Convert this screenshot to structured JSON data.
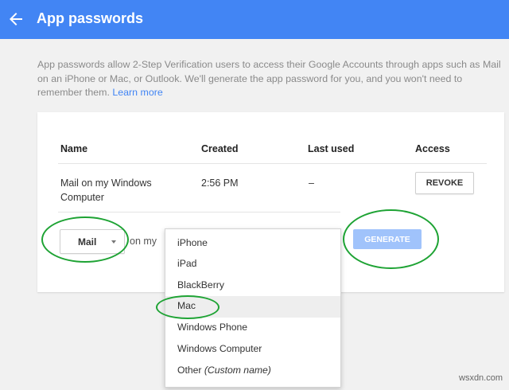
{
  "header": {
    "title": "App passwords",
    "back_icon": "arrow-left-icon",
    "color": "#4285f4"
  },
  "intro": {
    "text": "App passwords allow 2-Step Verification users to access their Google Accounts through apps such as Mail on an iPhone or Mac, or Outlook. We'll generate the app password for you, and you won't need to remember them.",
    "link": "Learn more"
  },
  "table": {
    "columns": [
      "Name",
      "Created",
      "Last used",
      "Access"
    ],
    "rows": [
      {
        "name_line1": "Mail on my Windows",
        "name_line2": "Computer",
        "created": "2:56 PM",
        "last_used": "–",
        "action": "REVOKE"
      }
    ]
  },
  "generator": {
    "app_selected": "Mail",
    "connector": "on my",
    "button": "GENERATE"
  },
  "device_menu": {
    "items": [
      {
        "label": "iPhone"
      },
      {
        "label": "iPad"
      },
      {
        "label": "BlackBerry"
      },
      {
        "label": "Mac",
        "highlighted": true
      },
      {
        "label": "Windows Phone"
      },
      {
        "label": "Windows Computer"
      },
      {
        "label": "Other",
        "suffix": "(Custom name)"
      }
    ]
  },
  "annotations": {
    "ring_color": "#1ea334"
  },
  "watermark": "wsxdn.com"
}
